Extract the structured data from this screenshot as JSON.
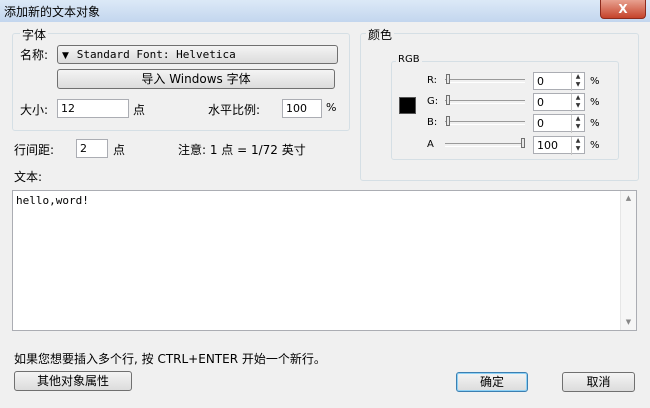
{
  "window": {
    "title": "添加新的文本对象",
    "close_label": "X"
  },
  "font_group": {
    "label": "字体",
    "name_label": "名称:",
    "font_value": "Standard Font: Helvetica",
    "import_button": "导入 Windows 字体",
    "size_label": "大小:",
    "size_value": "12",
    "size_unit": "点",
    "hscale_label": "水平比例:",
    "hscale_value": "100",
    "hscale_unit": "%"
  },
  "line_spacing": {
    "label": "行间距:",
    "value": "2",
    "unit": "点"
  },
  "note": "注意: 1 点 = 1/72 英寸",
  "color_group": {
    "label": "颜色",
    "rgb_label": "RGB",
    "swatch_color": "#000000",
    "channels": [
      {
        "label": "R:",
        "value": "0",
        "unit": "%",
        "level": 0
      },
      {
        "label": "G:",
        "value": "0",
        "unit": "%",
        "level": 0
      },
      {
        "label": "B:",
        "value": "0",
        "unit": "%",
        "level": 0
      },
      {
        "label": "A",
        "value": "100",
        "unit": "%",
        "level": 1
      }
    ]
  },
  "text_section": {
    "label": "文本:",
    "content": "hello,word!"
  },
  "hint": "如果您想要插入多个行, 按 CTRL+ENTER 开始一个新行。",
  "buttons": {
    "other_props": "其他对象属性",
    "ok": "确定",
    "cancel": "取消"
  },
  "icons": {
    "dropdown": "triangle-down-icon",
    "spin": "spinner-arrows-icon",
    "scroll_up": "scroll-up-icon",
    "scroll_down": "scroll-down-icon"
  }
}
